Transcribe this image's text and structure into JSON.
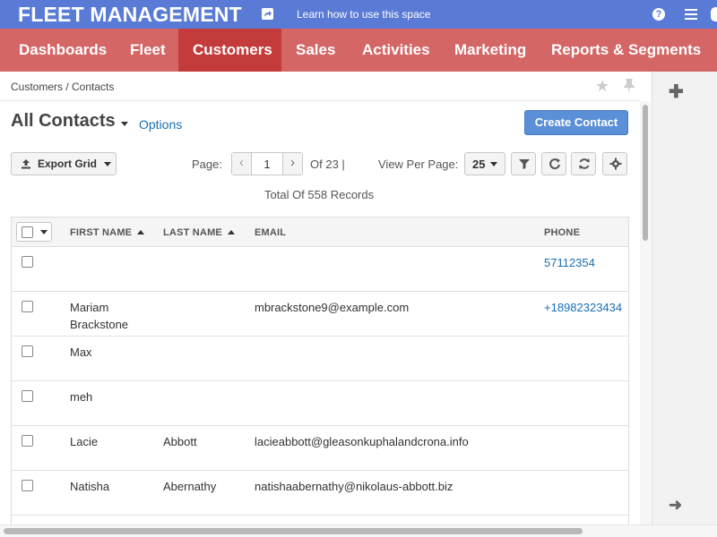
{
  "header": {
    "brand": "FLEET MANAGEMENT",
    "learn_link": "Learn how to use this space",
    "help": "?"
  },
  "nav": {
    "items": [
      {
        "label": "Dashboards"
      },
      {
        "label": "Fleet"
      },
      {
        "label": "Customers",
        "active": true
      },
      {
        "label": "Sales"
      },
      {
        "label": "Activities"
      },
      {
        "label": "Marketing"
      },
      {
        "label": "Reports & Segments"
      }
    ]
  },
  "breadcrumb": "Customers / Contacts",
  "page": {
    "title": "All Contacts",
    "options_link": "Options",
    "create_button": "Create Contact"
  },
  "toolbar": {
    "export_label": "Export Grid",
    "page_label": "Page:",
    "current_page": "1",
    "of_label": "Of 23 |",
    "view_per_page_label": "View Per Page:",
    "per_page_value": "25",
    "total_records": "Total Of 558 Records"
  },
  "grid": {
    "columns": {
      "first_name": "FIRST NAME",
      "last_name": "LAST NAME",
      "email": "EMAIL",
      "phone": "PHONE"
    },
    "rows": [
      {
        "first": "",
        "last": "",
        "email": "",
        "phone": "57112354"
      },
      {
        "first": "Mariam Brackstone",
        "last": "",
        "email": "mbrackstone9@example.com",
        "phone": "+18982323434"
      },
      {
        "first": "Max",
        "last": "",
        "email": "",
        "phone": ""
      },
      {
        "first": "meh",
        "last": "",
        "email": "",
        "phone": ""
      },
      {
        "first": "Lacie",
        "last": "Abbott",
        "email": "lacieabbott@gleasonkuphalandcrona.info",
        "phone": ""
      },
      {
        "first": "Natisha",
        "last": "Abernathy",
        "email": "natishaabernathy@nikolaus-abbott.biz",
        "phone": ""
      },
      {
        "first": "",
        "last": "",
        "email": "",
        "phone": ""
      }
    ]
  },
  "colors": {
    "header_bg": "#5a7bd5",
    "nav_bg": "#d46666",
    "nav_active_bg": "#c43b3b",
    "primary_button": "#5b8fd7",
    "link": "#1a6fb5"
  }
}
